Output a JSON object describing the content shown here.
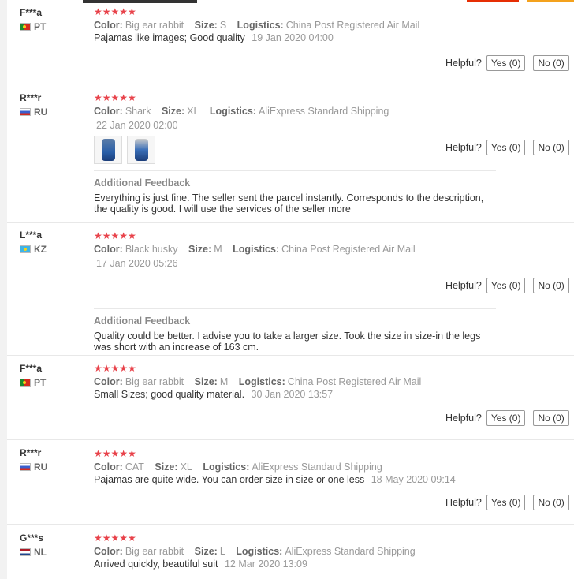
{
  "helpful_label": "Helpful?",
  "reviews": [
    {
      "user": "F***a",
      "country": "PT",
      "stars": "★★★★★",
      "color_label": "Color:",
      "color": "Big ear rabbit",
      "size_label": "Size:",
      "size": "S",
      "logistics_label": "Logistics:",
      "logistics": "China Post Registered Air Mail",
      "text": "Pajamas like images; Good quality",
      "date": "19 Jan 2020 04:00",
      "yes": "Yes (0)",
      "no": "No (0)"
    },
    {
      "user": "R***r",
      "country": "RU",
      "stars": "★★★★★",
      "color_label": "Color:",
      "color": "Shark",
      "size_label": "Size:",
      "size": "XL",
      "logistics_label": "Logistics:",
      "logistics": "AliExpress Standard Shipping",
      "date": "22 Jan 2020 02:00",
      "yes": "Yes (0)",
      "no": "No (0)",
      "additional_title": "Additional Feedback",
      "additional_text": "Everything is just fine. The seller sent the parcel instantly. Corresponds to the description, the quality is good. I will use the services of the seller more"
    },
    {
      "user": "L***a",
      "country": "KZ",
      "stars": "★★★★★",
      "color_label": "Color:",
      "color": "Black husky",
      "size_label": "Size:",
      "size": "M",
      "logistics_label": "Logistics:",
      "logistics": "China Post Registered Air Mail",
      "date": "17 Jan 2020 05:26",
      "yes": "Yes (0)",
      "no": "No (0)",
      "additional_title": "Additional Feedback",
      "additional_text": "Quality could be better. I advise you to take a larger size. Took the size in size-in the legs was short with an increase of 163 cm."
    },
    {
      "user": "F***a",
      "country": "PT",
      "stars": "★★★★★",
      "color_label": "Color:",
      "color": "Big ear rabbit",
      "size_label": "Size:",
      "size": "M",
      "logistics_label": "Logistics:",
      "logistics": "China Post Registered Air Mail",
      "text": "Small Sizes; good quality material.",
      "date": "30 Jan 2020 13:57",
      "yes": "Yes (0)",
      "no": "No (0)"
    },
    {
      "user": "R***r",
      "country": "RU",
      "stars": "★★★★★",
      "color_label": "Color:",
      "color": "CAT",
      "size_label": "Size:",
      "size": "XL",
      "logistics_label": "Logistics:",
      "logistics": "AliExpress Standard Shipping",
      "text": "Pajamas are quite wide. You can order size in size or one less",
      "date": "18 May 2020 09:14",
      "yes": "Yes (0)",
      "no": "No (0)"
    },
    {
      "user": "G***s",
      "country": "NL",
      "stars": "★★★★★",
      "color_label": "Color:",
      "color": "Big ear rabbit",
      "size_label": "Size:",
      "size": "L",
      "logistics_label": "Logistics:",
      "logistics": "AliExpress Standard Shipping",
      "text": "Arrived quickly, beautiful suit",
      "date": "12 Mar 2020 13:09"
    }
  ]
}
